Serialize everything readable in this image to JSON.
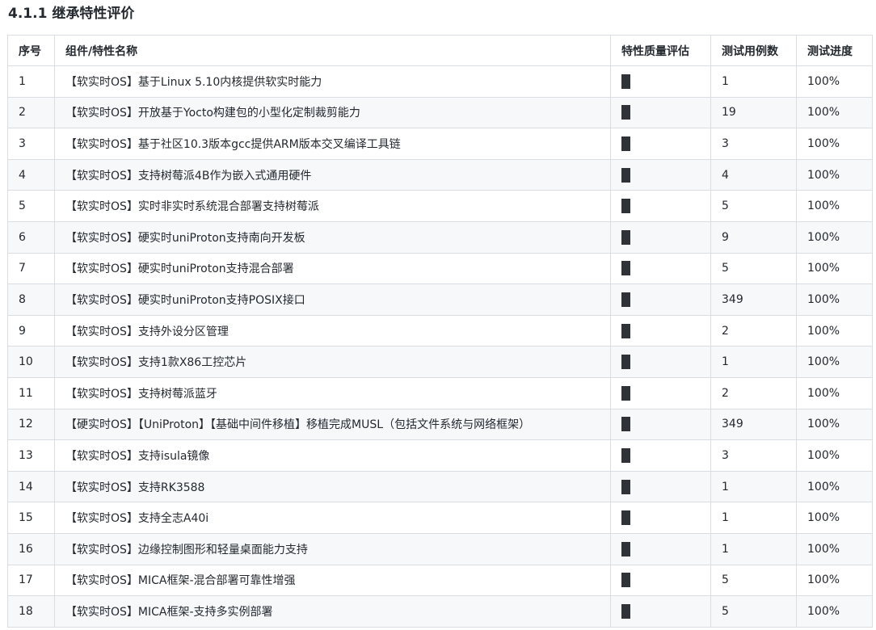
{
  "section": {
    "title": "4.1.1 继承特性评价"
  },
  "table": {
    "headers": {
      "index": "序号",
      "name": "组件/特性名称",
      "quality": "特性质量评估",
      "cases": "测试用例数",
      "progress": "测试进度"
    },
    "quality_color": "#2f3338",
    "rows": [
      {
        "index": "1",
        "name": "【软实时OS】基于Linux 5.10内核提供软实时能力",
        "cases": "1",
        "progress": "100%"
      },
      {
        "index": "2",
        "name": "【软实时OS】开放基于Yocto构建包的小型化定制裁剪能力",
        "cases": "19",
        "progress": "100%"
      },
      {
        "index": "3",
        "name": "【软实时OS】基于社区10.3版本gcc提供ARM版本交叉编译工具链",
        "cases": "3",
        "progress": "100%"
      },
      {
        "index": "4",
        "name": "【软实时OS】支持树莓派4B作为嵌入式通用硬件",
        "cases": "4",
        "progress": "100%"
      },
      {
        "index": "5",
        "name": "【软实时OS】实时非实时系统混合部署支持树莓派",
        "cases": "5",
        "progress": "100%"
      },
      {
        "index": "6",
        "name": "【软实时OS】硬实时uniProton支持南向开发板",
        "cases": "9",
        "progress": "100%"
      },
      {
        "index": "7",
        "name": "【软实时OS】硬实时uniProton支持混合部署",
        "cases": "5",
        "progress": "100%"
      },
      {
        "index": "8",
        "name": "【软实时OS】硬实时uniProton支持POSIX接口",
        "cases": "349",
        "progress": "100%"
      },
      {
        "index": "9",
        "name": "【软实时OS】支持外设分区管理",
        "cases": "2",
        "progress": "100%"
      },
      {
        "index": "10",
        "name": "【软实时OS】支持1款X86工控芯片",
        "cases": "1",
        "progress": "100%"
      },
      {
        "index": "11",
        "name": "【软实时OS】支持树莓派蓝牙",
        "cases": "2",
        "progress": "100%"
      },
      {
        "index": "12",
        "name": "【硬实时OS】【UniProton】【基础中间件移植】移植完成MUSL（包括文件系统与网络框架）",
        "cases": "349",
        "progress": "100%"
      },
      {
        "index": "13",
        "name": "【软实时OS】支持isula镜像",
        "cases": "3",
        "progress": "100%"
      },
      {
        "index": "14",
        "name": "【软实时OS】支持RK3588",
        "cases": "1",
        "progress": "100%"
      },
      {
        "index": "15",
        "name": "【软实时OS】支持全志A40i",
        "cases": "1",
        "progress": "100%"
      },
      {
        "index": "16",
        "name": "【软实时OS】边缘控制图形和轻量桌面能力支持",
        "cases": "1",
        "progress": "100%"
      },
      {
        "index": "17",
        "name": "【软实时OS】MICA框架-混合部署可靠性增强",
        "cases": "5",
        "progress": "100%"
      },
      {
        "index": "18",
        "name": "【软实时OS】MICA框架-支持多实例部署",
        "cases": "5",
        "progress": "100%"
      }
    ]
  }
}
